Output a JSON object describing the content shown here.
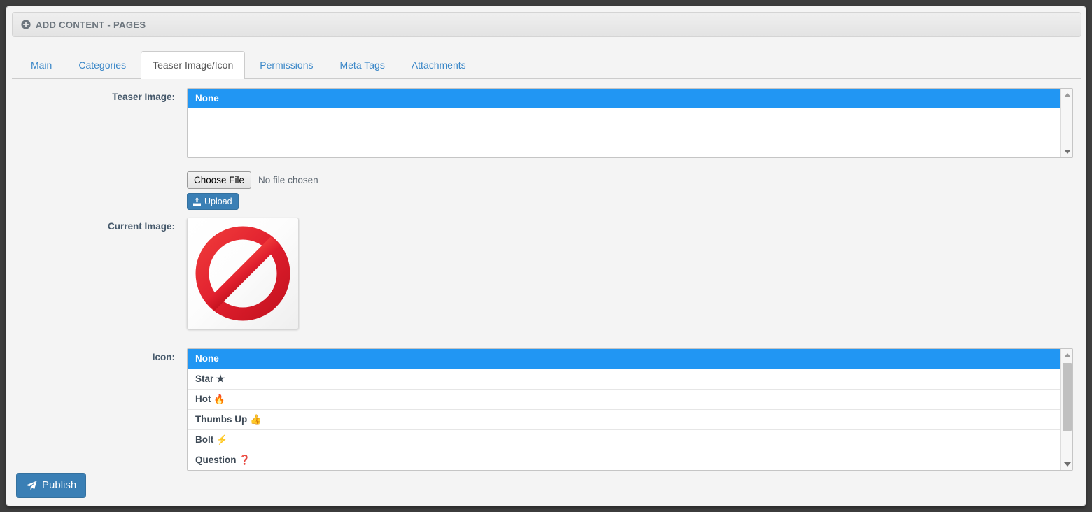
{
  "window": {
    "header_title": "ADD CONTENT - PAGES",
    "header_icon": "plus-circle-icon",
    "background_color": "#3d3d3d",
    "panel_background": "#f4f4f4"
  },
  "tabs": [
    {
      "label": "Main",
      "active": false
    },
    {
      "label": "Categories",
      "active": false
    },
    {
      "label": "Teaser Image/Icon",
      "active": true
    },
    {
      "label": "Permissions",
      "active": false
    },
    {
      "label": "Meta Tags",
      "active": false
    },
    {
      "label": "Attachments",
      "active": false
    }
  ],
  "form": {
    "teaser_image": {
      "label": "Teaser Image:",
      "options": [
        {
          "label": "None",
          "selected": true
        }
      ],
      "scroll": {
        "thumb_top_pct": 0,
        "thumb_height_pct": 0
      }
    },
    "upload": {
      "choose_file_label": "Choose File",
      "no_file_text": "No file chosen",
      "upload_label": "Upload",
      "upload_icon": "upload-icon",
      "button_color": "#3a7fb5"
    },
    "current_image": {
      "label": "Current Image:",
      "image_alt": "no-entry-sign",
      "image_color": "#e02232"
    },
    "icon": {
      "label": "Icon:",
      "options": [
        {
          "label": "None",
          "glyph": "",
          "selected": true
        },
        {
          "label": "Star",
          "glyph": "★",
          "selected": false
        },
        {
          "label": "Hot",
          "glyph": "🔥",
          "selected": false
        },
        {
          "label": "Thumbs Up",
          "glyph": "👍",
          "selected": false
        },
        {
          "label": "Bolt",
          "glyph": "⚡",
          "selected": false
        },
        {
          "label": "Question",
          "glyph": "❓",
          "selected": false
        }
      ],
      "scroll": {
        "thumb_top_pct": 2,
        "thumb_height_pct": 70
      }
    }
  },
  "footer": {
    "publish_label": "Publish",
    "publish_icon": "paper-plane-icon",
    "publish_color": "#3a7fb5"
  },
  "colors": {
    "accent_blue": "#2196f3",
    "link_blue": "#3a87c8",
    "label_text": "#46596b",
    "header_text": "#6c757d"
  }
}
